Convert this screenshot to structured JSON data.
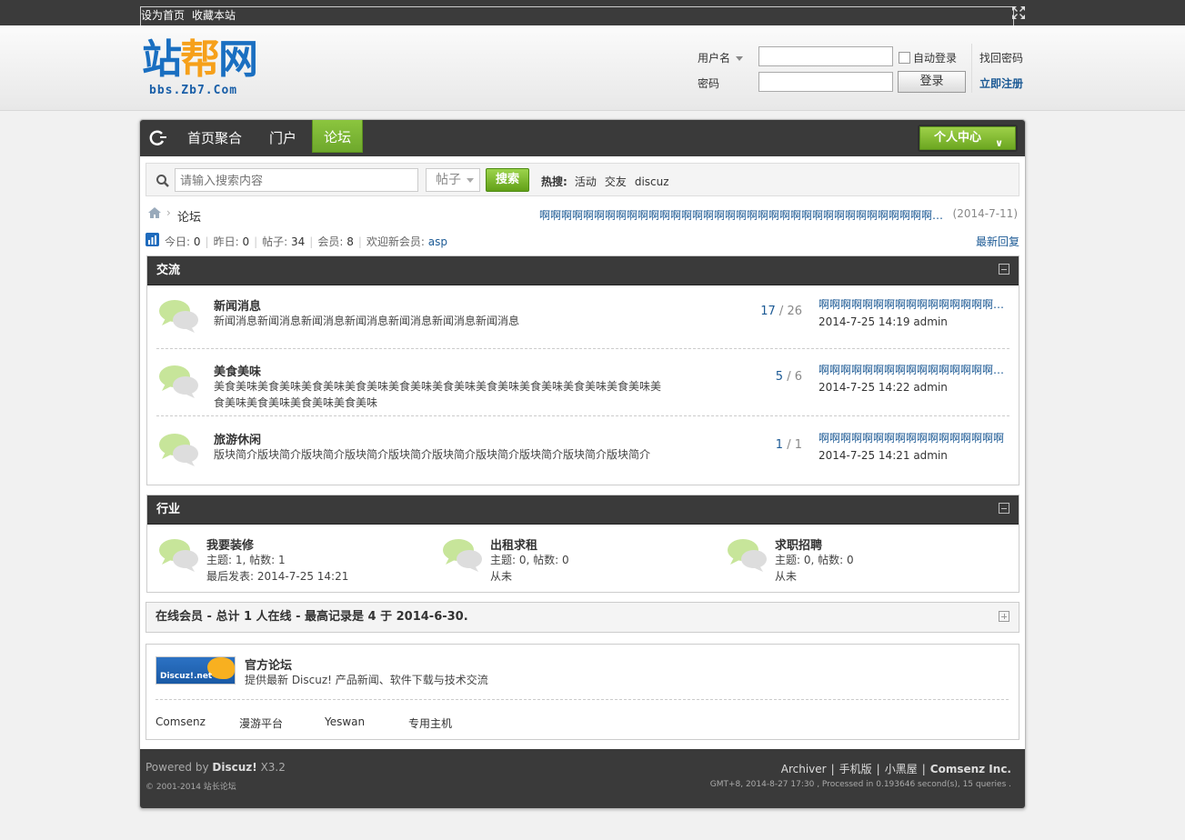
{
  "topbar": {
    "set_home": "设为首页",
    "favorite": "收藏本站"
  },
  "logo": {
    "text_a": "站",
    "text_b": "帮",
    "text_c": "网",
    "domain": "bbs.Zb7.Com"
  },
  "login": {
    "username_label": "用户名",
    "password_label": "密码",
    "auto_login": "自动登录",
    "forgot": "找回密码",
    "login_button": "登录",
    "register": "立即注册"
  },
  "nav": {
    "items": [
      "首页聚合",
      "门户",
      "论坛"
    ],
    "active": "论坛",
    "user_center": "个人中心"
  },
  "search": {
    "placeholder": "请输入搜索内容",
    "type": "帖子",
    "button": "搜索",
    "hot_label": "热搜:",
    "hot": [
      "活动",
      "交友",
      "discuz"
    ]
  },
  "breadcrumb": {
    "current": "论坛",
    "announcement": "啊啊啊啊啊啊啊啊啊啊啊啊啊啊啊啊啊啊啊啊啊啊啊啊啊啊啊啊啊啊啊啊啊啊啊啊啊啊啊啊啊啊啊...",
    "announcement_date": "(2014-7-11)"
  },
  "stats": {
    "today_label": "今日:",
    "today": "0",
    "yesterday_label": "昨日:",
    "yesterday": "0",
    "posts_label": "帖子:",
    "posts": "34",
    "members_label": "会员:",
    "members": "8",
    "welcome_label": "欢迎新会员:",
    "new_member": "asp",
    "latest_reply": "最新回复"
  },
  "categories": [
    {
      "title": "交流",
      "forums": [
        {
          "name": "新闻消息",
          "desc": "新闻消息新闻消息新闻消息新闻消息新闻消息新闻消息新闻消息",
          "threads": "17",
          "posts": "26",
          "last_title": "啊啊啊啊啊啊啊啊啊啊啊啊啊啊啊啊啊 ...",
          "last_meta": "2014-7-25 14:19 admin"
        },
        {
          "name": "美食美味",
          "desc": "美食美味美食美味美食美味美食美味美食美味美食美味美食美味美食美味美食美味美食美味美食美味美食美味美食美味美食美味",
          "threads": "5",
          "posts": "6",
          "last_title": "啊啊啊啊啊啊啊啊啊啊啊啊啊啊啊啊啊啊啊",
          "last_meta": "2014-7-25 14:22 admin"
        },
        {
          "name": "旅游休闲",
          "desc": "版块简介版块简介版块简介版块简介版块简介版块简介版块简介版块简介版块简介版块简介",
          "threads": "1",
          "posts": "1",
          "last_title": "啊啊啊啊啊啊啊啊啊啊啊啊啊啊啊啊啊",
          "last_meta": "2014-7-25 14:21 admin"
        }
      ]
    },
    {
      "title": "行业",
      "forums": [
        {
          "name": "我要装修",
          "line1": "主题: 1, 帖数: 1",
          "line2": "最后发表: 2014-7-25 14:21"
        },
        {
          "name": "出租求租",
          "line1": "主题: 0, 帖数: 0",
          "line2": "从未"
        },
        {
          "name": "求职招聘",
          "line1": "主题: 0, 帖数: 0",
          "line2": "从未"
        }
      ]
    }
  ],
  "online": {
    "text": "在线会员 - 总计 1 人在线 - 最高记录是 4 于 2014-6-30."
  },
  "friend_links": {
    "featured_logo_text": "Discuz!.net",
    "featured_name": "官方论坛",
    "featured_desc": "提供最新 Discuz! 产品新闻、软件下载与技术交流",
    "text_links": [
      "Comsenz",
      "漫游平台",
      "Yeswan",
      "专用主机"
    ]
  },
  "footer": {
    "powered_by": "Powered by",
    "product": "Discuz!",
    "version": "X3.2",
    "copyright": "© 2001-2014 站长论坛",
    "links": [
      "Archiver",
      "手机版",
      "小黑屋"
    ],
    "company": "Comsenz Inc.",
    "gmt": "GMT+8, 2014-8-27 17:30 , Processed in 0.193646 second(s), 15 queries ."
  },
  "colors": {
    "accent_green": "#8cc63f",
    "nav_dark": "#3a3a3a",
    "link_blue": "#1c5a95"
  }
}
